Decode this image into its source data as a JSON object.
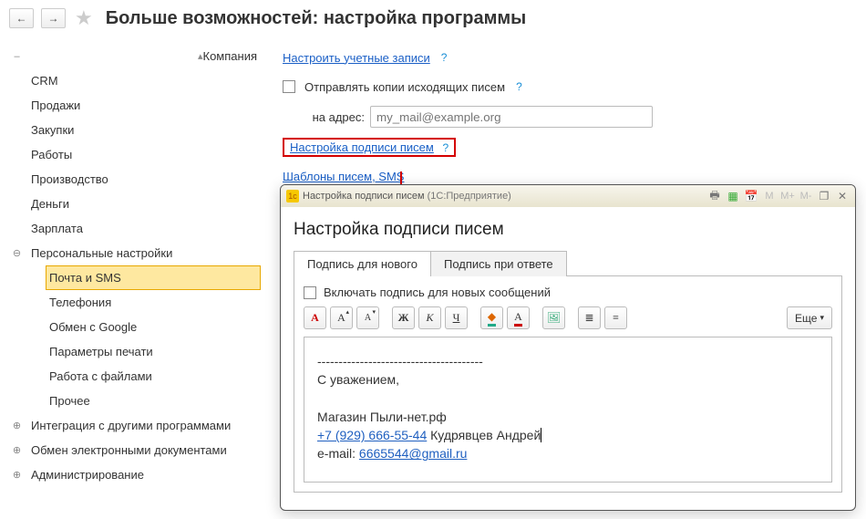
{
  "header": {
    "title": "Больше возможностей: настройка программы"
  },
  "sidebar": {
    "items": [
      {
        "label": "Компания",
        "toggle": "minus"
      },
      {
        "label": "CRM"
      },
      {
        "label": "Продажи"
      },
      {
        "label": "Закупки"
      },
      {
        "label": "Работы"
      },
      {
        "label": "Производство"
      },
      {
        "label": "Деньги"
      },
      {
        "label": "Зарплата"
      },
      {
        "label": "Персональные настройки",
        "toggle": "minus"
      },
      {
        "label": "Почта и SMS",
        "active": true,
        "indent": true
      },
      {
        "label": "Телефония",
        "indent": true
      },
      {
        "label": "Обмен с Google",
        "indent": true
      },
      {
        "label": "Параметры печати",
        "indent": true
      },
      {
        "label": "Работа с файлами",
        "indent": true
      },
      {
        "label": "Прочее",
        "indent": true
      },
      {
        "label": "Интеграция с другими программами",
        "toggle": "plus"
      },
      {
        "label": "Обмен электронными документами",
        "toggle": "plus"
      },
      {
        "label": "Администрирование",
        "toggle": "plus"
      }
    ]
  },
  "main": {
    "configure_accounts": "Настроить учетные записи",
    "send_copies": "Отправлять копии исходящих писем",
    "to_address_label": "на адрес:",
    "to_address_placeholder": "my_mail@example.org",
    "signature_settings": "Настройка подписи писем",
    "mail_templates": "Шаблоны писем, SMS",
    "help": "?"
  },
  "modal": {
    "window_title": "Настройка подписи писем",
    "app_suffix": "(1С:Предприятие)",
    "heading": "Настройка подписи писем",
    "tabs": [
      "Подпись для нового",
      "Подпись при ответе"
    ],
    "include_for_new": "Включать подпись для новых сообщений",
    "toolbar_more": "Еще",
    "toolbar_btns": {
      "bold": "Ж",
      "italic": "К",
      "underline": "Ч"
    },
    "titlebar_extra": {
      "m": "M",
      "mplus": "M+",
      "mminus": "M-"
    },
    "signature": {
      "divider": "---------------------------------------",
      "regards": "С уважением,",
      "company": "Магазин Пыли-нет.рф",
      "phone": "+7 (929) 666-55-44",
      "name": "Кудрявцев Андрей",
      "email_label": "e-mail:",
      "email": "6665544@gmail.ru"
    }
  }
}
